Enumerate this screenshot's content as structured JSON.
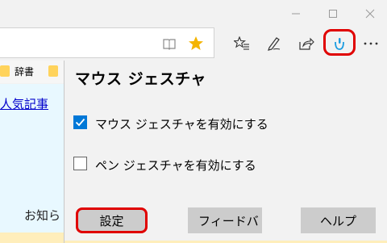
{
  "window": {
    "minimize_icon": "minimize-icon",
    "maximize_icon": "maximize-icon",
    "close_icon": "close-icon"
  },
  "toolbar": {
    "icons": [
      "reading-view-icon",
      "favorite-star-icon",
      "favorites-hub-icon",
      "pen-icon",
      "share-icon",
      "mouse-gesture-extension-icon",
      "more-icon"
    ],
    "star_color": "#f4b400",
    "highlight_color": "#e00000"
  },
  "favorites_bar": {
    "item_label": "辞書"
  },
  "page": {
    "link_text": "人気記事",
    "info_text": "お知ら"
  },
  "panel": {
    "title": "マウス ジェスチャ",
    "options": [
      {
        "label": "マウス ジェスチャを有効にする",
        "checked": true
      },
      {
        "label": "ペン ジェスチャを有効にする",
        "checked": false
      }
    ],
    "buttons": {
      "settings": "設定",
      "feedback": "フィードバ",
      "help": "ヘルプ"
    }
  }
}
